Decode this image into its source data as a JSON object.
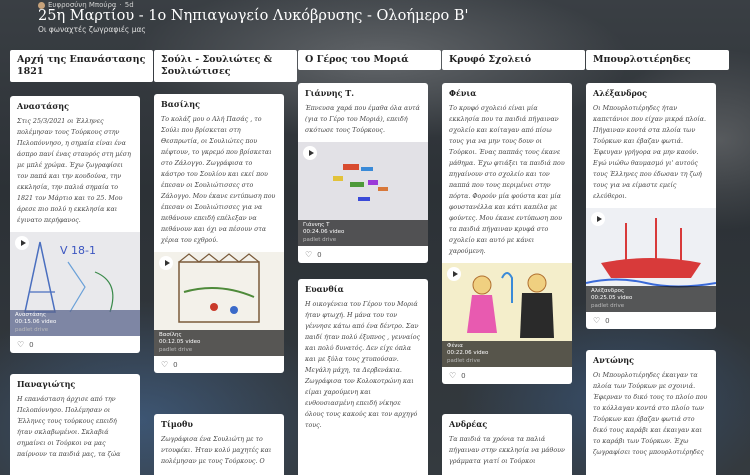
{
  "header": {
    "author": "Ευφροσύνη Μπούρα",
    "age": "5d",
    "title": "25η Μαρτίου - 1ο Νηπιαγωγείο Λυκόβρυσης - Ολοήμερο Β'",
    "subtitle": "Οι φωναχτές ζωγραφιές μας"
  },
  "columns": [
    {
      "title": "Αρχή της Επανάστασης 1821",
      "cards": [
        {
          "title": "Αναστάσης",
          "body": "Στις 25/3/2021 οι Έλληνες πολέμησαν τους Τούρκους στην Πελοπόννησο, η σημαία είναι ένα άσπρο πανί ένας σταυρός στη μέση με μπλέ χρώμα. Έχω ζωγραφίσει τον παπά και την κουδούνα, την εκκλησία, την παλιά σημαία το 1821 τον Μάρτιο και το 25. Μου άρεσε πιο πολύ η εκκλησία και έγινατο περήφανος.",
          "media_name": "Αναστάσης",
          "media_meta": "00:15.06 video",
          "media_source": "padlet drive",
          "likes": "0"
        },
        {
          "title": "Παναγιώτης",
          "body": "Η επανάσταση άρχισε από την Πελοπόννησο. Πολέμησαν οι Έλληνες τους τούρκους επειδή ήταν σκλαβωμένοι. Σκλαβιά σημαίνει οι Τούρκοι να μας παίρνουν τα παιδιά μας, τα ζώα"
        }
      ]
    },
    {
      "title": "Σούλι - Σουλιώτες & Σουλιώτισες",
      "cards": [
        {
          "title": "Βασίλης",
          "body": "Το κολάζ μου ο Αλή Πασάς , το Σούλι που βρίσκεται στη Θεσπρωτία, οι Σουλιώτες που πέφτουν, το γκρεμό που βρίσκεται στο Ζάλογγο. Ζωγράφισα το κάστρο του Σουλίου και εκεί που έπεσαν οι Σουλιώτισσες στο Ζάλογγο. Μου έκανε εντύπωση που έπεσαν οι Σουλιώτισσες για να πεθάνουν επειδή επέλεξαν να πεθάνουν και όχι να πέσουν στα χέρια του εχθρού.",
          "media_name": "Βασίλης",
          "media_meta": "00:12.05 video",
          "media_source": "padlet drive",
          "likes": "0"
        },
        {
          "title": "Τίμοθυ",
          "body": "Ζωγράφισα ένα Σουλιώτη με το ντουφέκι. Ήταν κολύ μαχητές και πολέμησαν με τους Τούρκους. Ο"
        }
      ]
    },
    {
      "title": "Ο Γέρος του Μοριά",
      "cards": [
        {
          "title": "Γιάννης Τ.",
          "body": "Έπνευσα χαρά που έμαθα όλα αυτά (για το Γέρο του Μοριά), επειδή σκότωσε τους Τούρκους.",
          "media_name": "Γιάννης Τ",
          "media_meta": "00:24.06 video",
          "media_source": "padlet drive",
          "likes": "0"
        },
        {
          "title": "Ευανθία",
          "body": "Η οικογένεια του Γέρου του Μοριά ήταν φτωχή. Η μάνα του τον γέννησε κάτω από ένα δέντρο. Σαν παιδί ήταν πολύ έξυπνος , γενναίος και πολύ δυνατός. Δεν είχε όπλα και με ξύλα τους χτυπούσαν. Μεγάλη μάχη, τα Δερβενάκια. Ζωγράφισα τον Κολοκοτρώνη και είμαι χαρούμενη και ενθουσιασμένη επειδή νίκησε όλους τους κακούς και τον αρχηγό τους."
        }
      ]
    },
    {
      "title": "Κρυφό Σχολειό",
      "cards": [
        {
          "title": "Φένια",
          "body": "Το κρυφό σχολειό είναι μία εκκλησία που τα παιδιά πήγαιναν σχολείο και κοίταγαν από πίσω τους για να μην τους δουν οι Τούρκοι. Ένας παππάς τους έκανε μάθημα. Έχω φτιάξει τα παιδιά που πηγαίνουν στο σχολείο και τον παππά που τους περιμένει στην πόρτα. Φορούν μία φούστα και μία φουστανέλλα και κάτι καπέλα με φούντες. Μου έκανε εντύπωση που τα παιδιά πήγαιναν κρυφά στο σχολείο και αυτό με κάνει χαρούμενη.",
          "media_name": "Φένια",
          "media_meta": "00:22.06 video",
          "media_source": "padlet drive",
          "likes": "0"
        },
        {
          "title": "Ανδρέας",
          "body": "Τα παιδιά τα χρόνια τα παλιά πήγαιναν στην εκκλησία να μάθουν γράμματα γιατί οι Τούρκοι"
        }
      ]
    },
    {
      "title": "Μπουρλοτιέρηδες",
      "cards": [
        {
          "title": "Αλέξανδρος",
          "body": "Οι Μπουρλοτιέρηδες ήταν καπετάνιοι που είχαν μικρά πλοία. Πήγαιναν κοντά στα πλοία των Τούρκων και έβαζαν φωτιά. Έφευγαν γρήγορα να μην καούν. Εγώ νιώθω θαυμασμό γι' αυτούς τους Έλληνες που έδωσαν τη ζωή τους για να είμαστε εμείς ελεύθεροι.",
          "media_name": "Αλέξανδρος",
          "media_meta": "00:25.05 video",
          "media_source": "padlet drive",
          "likes": "0"
        },
        {
          "title": "Αντώνης",
          "body": "Οι Μπουρλοτιέρηδες έκαιγαν τα πλοία των Τούρκων με σχοινιά. Έφερναν το δικό τους το πλοίο που το κόλλαγαν κοντά στο πλοίο των Τούρκων και έβαζαν φωτιά στο δικό τους καράβι και έκαιγαν και το καράβι των Τούρκων. Έχω ζωγραφίσει τους μπουρλοτιέρηδες"
        }
      ]
    }
  ]
}
